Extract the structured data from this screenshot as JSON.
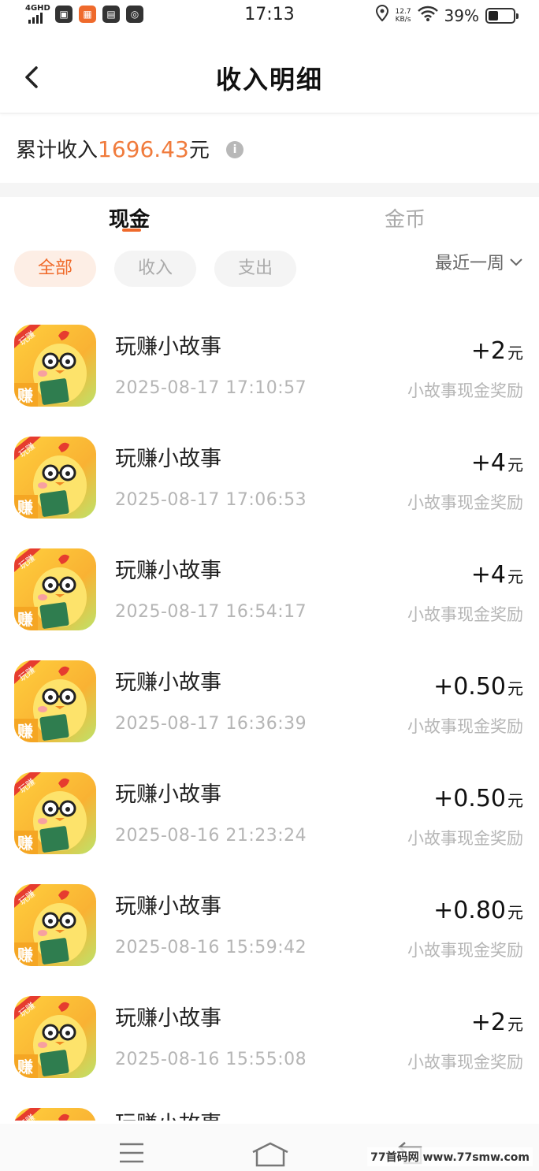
{
  "status_bar": {
    "network": "4GHD",
    "time": "17:13",
    "speed_value": "12.7",
    "speed_unit": "KB/s",
    "battery": "39%"
  },
  "header": {
    "title": "收入明细"
  },
  "summary": {
    "prefix": "累计收入",
    "amount": "1696.43",
    "unit": "元"
  },
  "tabs": [
    {
      "label": "现金",
      "active": true
    },
    {
      "label": "金币",
      "active": false
    }
  ],
  "filters": {
    "chips": [
      "全部",
      "收入",
      "支出"
    ],
    "active": "全部",
    "period": "最近一周"
  },
  "records": [
    {
      "name": "玩赚小故事",
      "time": "2025-08-17 17:10:57",
      "amount": "+2",
      "unit": "元",
      "desc": "小故事现金奖励"
    },
    {
      "name": "玩赚小故事",
      "time": "2025-08-17 17:06:53",
      "amount": "+4",
      "unit": "元",
      "desc": "小故事现金奖励"
    },
    {
      "name": "玩赚小故事",
      "time": "2025-08-17 16:54:17",
      "amount": "+4",
      "unit": "元",
      "desc": "小故事现金奖励"
    },
    {
      "name": "玩赚小故事",
      "time": "2025-08-17 16:36:39",
      "amount": "+0.50",
      "unit": "元",
      "desc": "小故事现金奖励"
    },
    {
      "name": "玩赚小故事",
      "time": "2025-08-16 21:23:24",
      "amount": "+0.50",
      "unit": "元",
      "desc": "小故事现金奖励"
    },
    {
      "name": "玩赚小故事",
      "time": "2025-08-16 15:59:42",
      "amount": "+0.80",
      "unit": "元",
      "desc": "小故事现金奖励"
    },
    {
      "name": "玩赚小故事",
      "time": "2025-08-16 15:55:08",
      "amount": "+2",
      "unit": "元",
      "desc": "小故事现金奖励"
    }
  ],
  "partial_record": {
    "name": "玩赚小故事"
  },
  "app_icon": {
    "badge_top": "玩赚",
    "badge_bottom": "赚"
  },
  "watermark": "77首码网 www.77smw.com",
  "colors": {
    "accent": "#ef6a2c",
    "amount": "#f07b3c"
  }
}
